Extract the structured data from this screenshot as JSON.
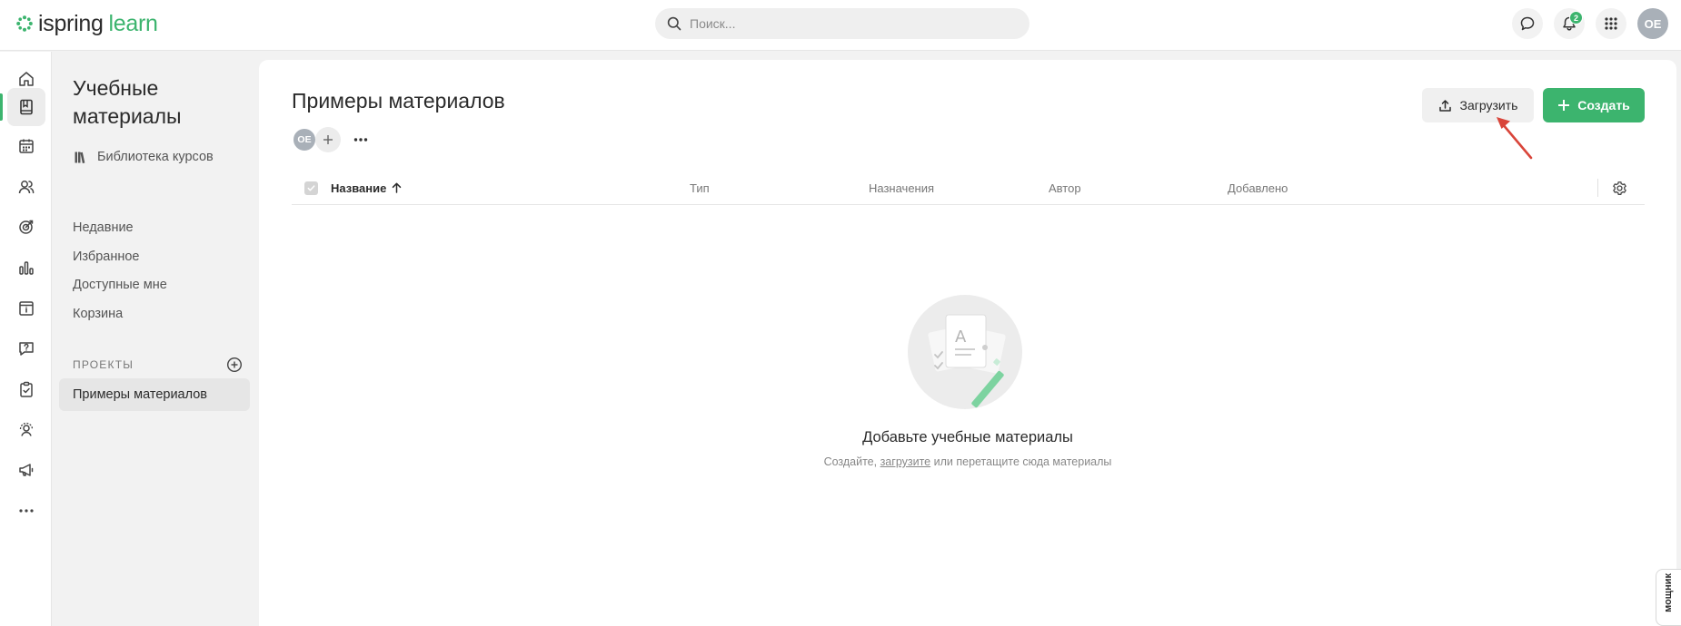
{
  "brand": {
    "part1": "ispring",
    "part2": "learn",
    "accent": "#3cb46e"
  },
  "search": {
    "placeholder": "Поиск..."
  },
  "topbar": {
    "notification_count": "2",
    "user_initials": "OE"
  },
  "rail": {
    "items": [
      {
        "icon": "home-icon"
      },
      {
        "icon": "book-icon",
        "active": true
      },
      {
        "icon": "calendar-icon"
      },
      {
        "icon": "users-icon"
      },
      {
        "icon": "target-icon"
      },
      {
        "icon": "chart-icon"
      },
      {
        "icon": "info-board-icon"
      },
      {
        "icon": "question-icon"
      },
      {
        "icon": "clipboard-check-icon"
      },
      {
        "icon": "user-settings-icon"
      },
      {
        "icon": "megaphone-icon"
      },
      {
        "icon": "more-icon"
      }
    ]
  },
  "sidebar": {
    "title": "Учебные материалы",
    "library": "Библиотека курсов",
    "links": [
      "Недавние",
      "Избранное",
      "Доступные мне",
      "Корзина"
    ],
    "projects_label": "ПРОЕКТЫ",
    "projects": [
      "Примеры материалов"
    ]
  },
  "main": {
    "title": "Примеры материалов",
    "owner_initials": "OE",
    "upload_label": "Загрузить",
    "create_label": "Создать"
  },
  "table": {
    "columns": [
      "Название",
      "Тип",
      "Назначения",
      "Автор",
      "Добавлено"
    ]
  },
  "empty_state": {
    "title": "Добавьте учебные материалы",
    "sub_before": "Создайте, ",
    "sub_link": "загрузите",
    "sub_after": " или перетащите сюда материалы"
  },
  "helper_tab": {
    "label": "мощник"
  }
}
